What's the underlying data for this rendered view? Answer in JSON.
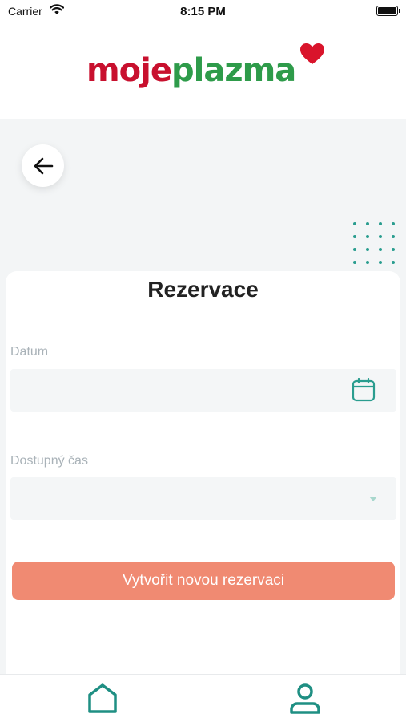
{
  "status_bar": {
    "carrier": "Carrier",
    "time": "8:15 PM"
  },
  "header": {
    "logo_part1": "moje",
    "logo_part2": "plazma",
    "logo_colors": {
      "moje": "#c8102e",
      "plazma": "#2e9b4a",
      "heart": "#d9142b"
    }
  },
  "main": {
    "title": "Rezervace",
    "date_field": {
      "label": "Datum",
      "value": "",
      "icon": "calendar-icon"
    },
    "time_field": {
      "label": "Dostupný čas",
      "value": "",
      "icon": "chevron-down-icon"
    },
    "submit_label": "Vytvořit novou rezervaci"
  },
  "tab_bar": {
    "items": [
      {
        "icon": "home-icon"
      },
      {
        "icon": "profile-icon"
      }
    ]
  },
  "colors": {
    "accent": "#2a9d8f",
    "button": "#f08a72",
    "background": "#f3f5f6"
  }
}
